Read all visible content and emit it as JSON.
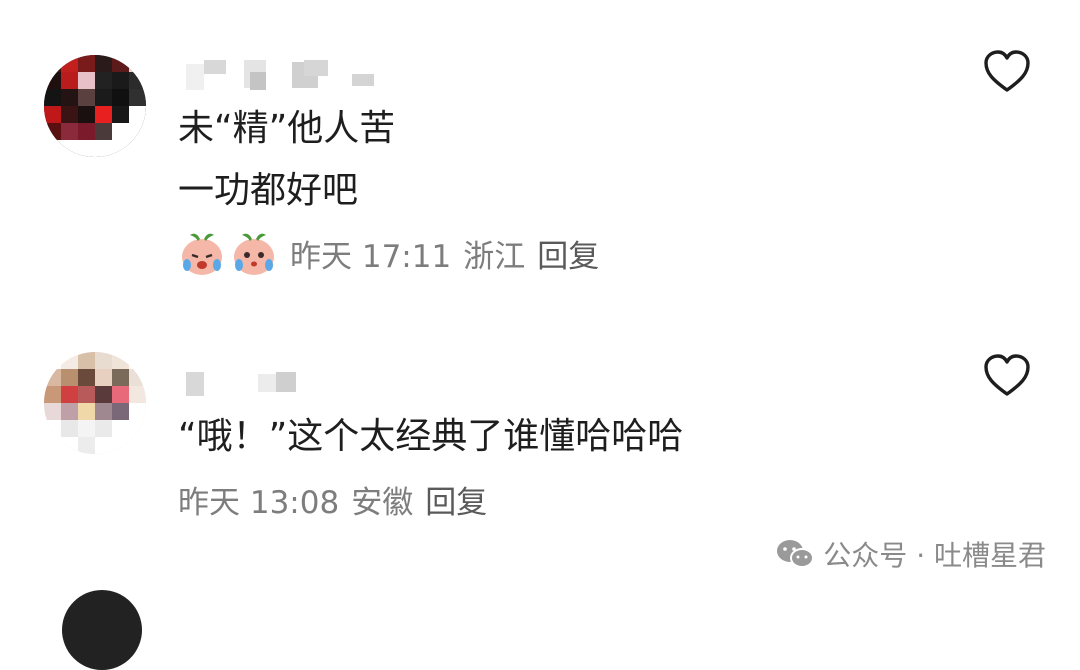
{
  "comments": [
    {
      "content_line1": "未“精”他人苦",
      "content_line2": "一功都好吧",
      "time": "昨天 17:11",
      "location": "浙江",
      "reply_label": "回复",
      "reactions": [
        "crying-peach-emoji",
        "crying-peach-emoji"
      ]
    },
    {
      "content_line1": "“哦！”这个太经典了谁懂哈哈哈",
      "time": "昨天 13:08",
      "location": "安徽",
      "reply_label": "回复"
    }
  ],
  "watermark": {
    "text": "公众号 · 吐槽星君",
    "icon": "wechat-icon"
  },
  "colors": {
    "text": "#1e1e1e",
    "meta": "#7d7d7d",
    "background": "#ffffff"
  }
}
